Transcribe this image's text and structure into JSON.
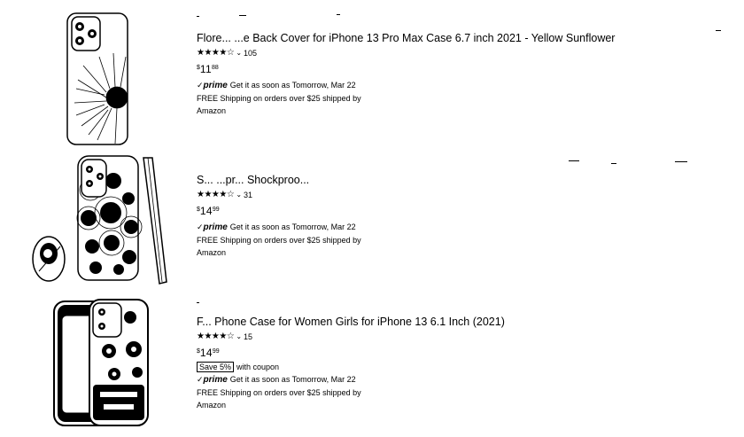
{
  "results": [
    {
      "title": "Flore... ...e Back Cover for iPhone 13 Pro Max Case 6.7 inch 2021 - Yellow Sunflower",
      "stars": "★★★★☆",
      "chevron": "⌄",
      "reviews": "105",
      "price_symbol": "$",
      "price_whole": "11",
      "price_cents": "88",
      "prime_check": "✓",
      "prime_label": "prime",
      "delivery": "Get it as soon as Tomorrow, Mar 22",
      "shipping": "FREE Shipping on orders over $25 shipped by",
      "seller": "Amazon"
    },
    {
      "title": "S...      ...pr... Shockproo...",
      "stars": "★★★★☆",
      "chevron": "⌄",
      "reviews": "31",
      "price_symbol": "$",
      "price_whole": "14",
      "price_cents": "99",
      "prime_check": "✓",
      "prime_label": "prime",
      "delivery": "Get it as soon as Tomorrow, Mar 22",
      "shipping": "FREE Shipping on orders over $25 shipped by",
      "seller": "Amazon"
    },
    {
      "title": "F... Phone Case for Women Girls for iPhone 13 6.1 Inch (2021)",
      "stars": "★★★★☆",
      "chevron": "⌄",
      "reviews": "15",
      "price_symbol": "$",
      "price_whole": "14",
      "price_cents": "99",
      "coupon_badge": "Save 5%",
      "coupon_text": "with coupon",
      "prime_check": "✓",
      "prime_label": "prime",
      "delivery": "Get it as soon as Tomorrow, Mar 22",
      "shipping": "FREE Shipping on orders over $25 shipped by",
      "seller": "Amazon"
    }
  ]
}
